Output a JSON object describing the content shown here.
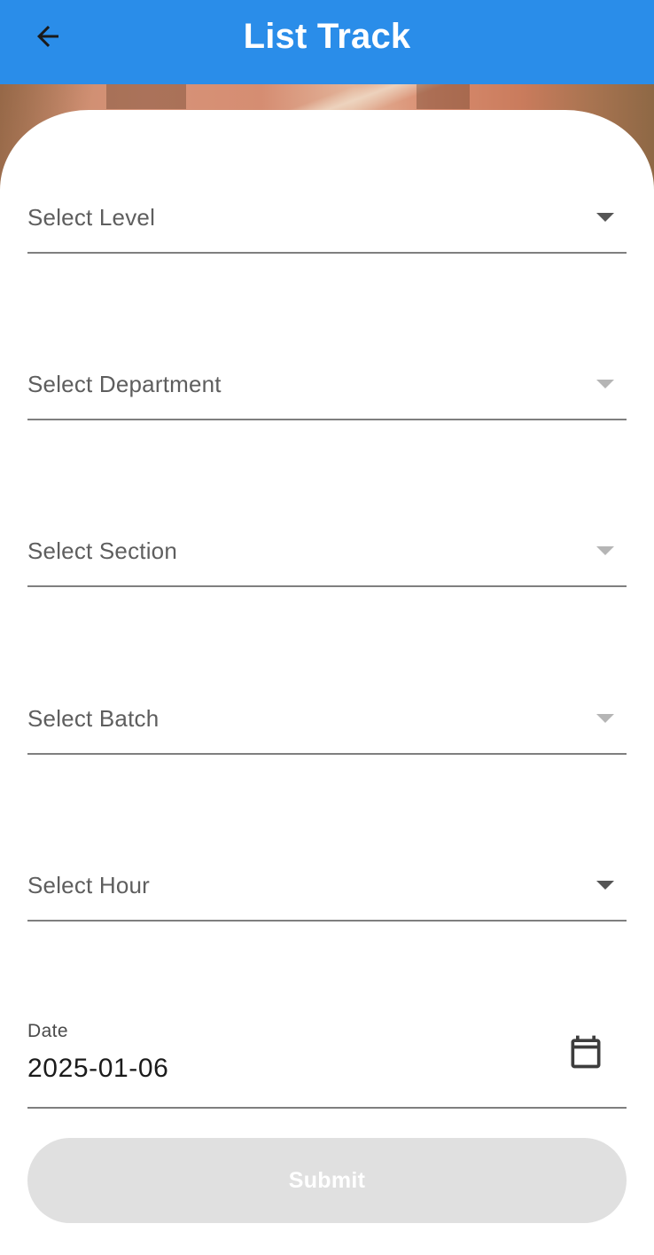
{
  "appbar": {
    "title": "List Track",
    "background_color": "#2a8de9",
    "back_icon": "arrow-left-icon"
  },
  "form": {
    "fields": [
      {
        "label": "Select Level",
        "enabled": true
      },
      {
        "label": "Select Department",
        "enabled": false
      },
      {
        "label": "Select Section",
        "enabled": false
      },
      {
        "label": "Select Batch",
        "enabled": false
      },
      {
        "label": "Select Hour",
        "enabled": true
      }
    ],
    "date": {
      "label": "Date",
      "value": "2025-01-06",
      "icon": "calendar-icon"
    },
    "submit": {
      "label": "Submit",
      "enabled": false
    }
  }
}
